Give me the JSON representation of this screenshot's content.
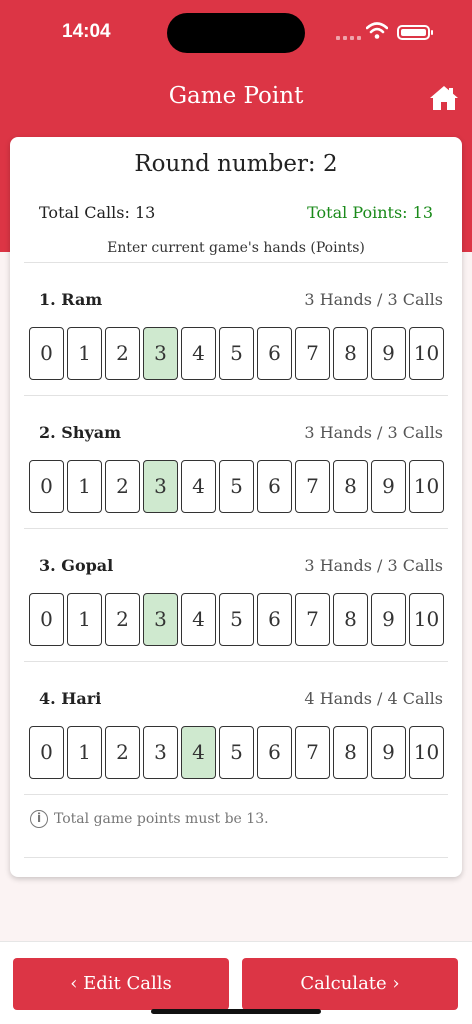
{
  "status": {
    "time": "14:04"
  },
  "header": {
    "title": "Game Point"
  },
  "card": {
    "round": "Round number: 2",
    "total_calls": "Total Calls: 13",
    "total_points": "Total Points: 13",
    "instruction": "Enter current game's hands (Points)",
    "players": [
      {
        "name": "1. Ram",
        "stat": "3 Hands / 3 Calls",
        "selected": 3
      },
      {
        "name": "2. Shyam",
        "stat": "3 Hands / 3 Calls",
        "selected": 3
      },
      {
        "name": "3. Gopal",
        "stat": "3 Hands / 3 Calls",
        "selected": 3
      },
      {
        "name": "4. Hari",
        "stat": "4 Hands / 4 Calls",
        "selected": 4
      }
    ],
    "options": [
      "0",
      "1",
      "2",
      "3",
      "4",
      "5",
      "6",
      "7",
      "8",
      "9",
      "10"
    ],
    "note": "Total game points must be 13."
  },
  "buttons": {
    "edit": "‹ Edit Calls",
    "calculate": "Calculate ›"
  },
  "colors": {
    "accent": "#dc3545",
    "selected": "#cfe9cf",
    "points": "#1a8a1a"
  }
}
